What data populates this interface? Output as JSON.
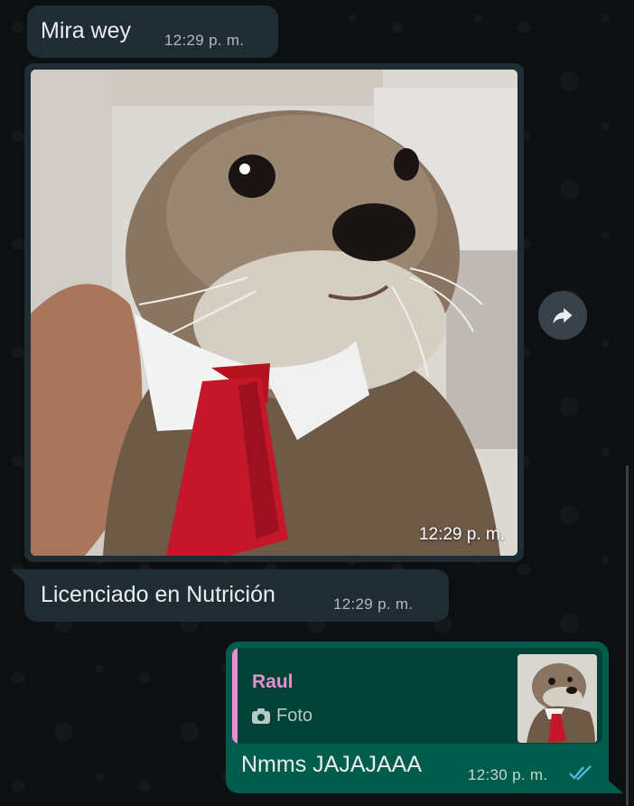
{
  "messages": {
    "first": {
      "text": "Mira wey",
      "time": "12:29 p. m."
    },
    "image": {
      "time": "12:29 p. m."
    },
    "third": {
      "text": "Licenciado en Nutrición",
      "time": "12:29 p. m."
    },
    "reply": {
      "quoted_name": "Raul",
      "quoted_type": "Foto",
      "text": "Nmms JAJAJAAA",
      "time": "12:30 p. m."
    }
  },
  "icons": {
    "forward": "forward-arrow-icon",
    "camera": "camera-icon",
    "ticks": "double-check-icon"
  },
  "colors": {
    "incoming_bubble": "#202c33",
    "outgoing_bubble": "#005c4b",
    "quote_accent": "#e58ed0",
    "read_ticks": "#53bdeb"
  }
}
